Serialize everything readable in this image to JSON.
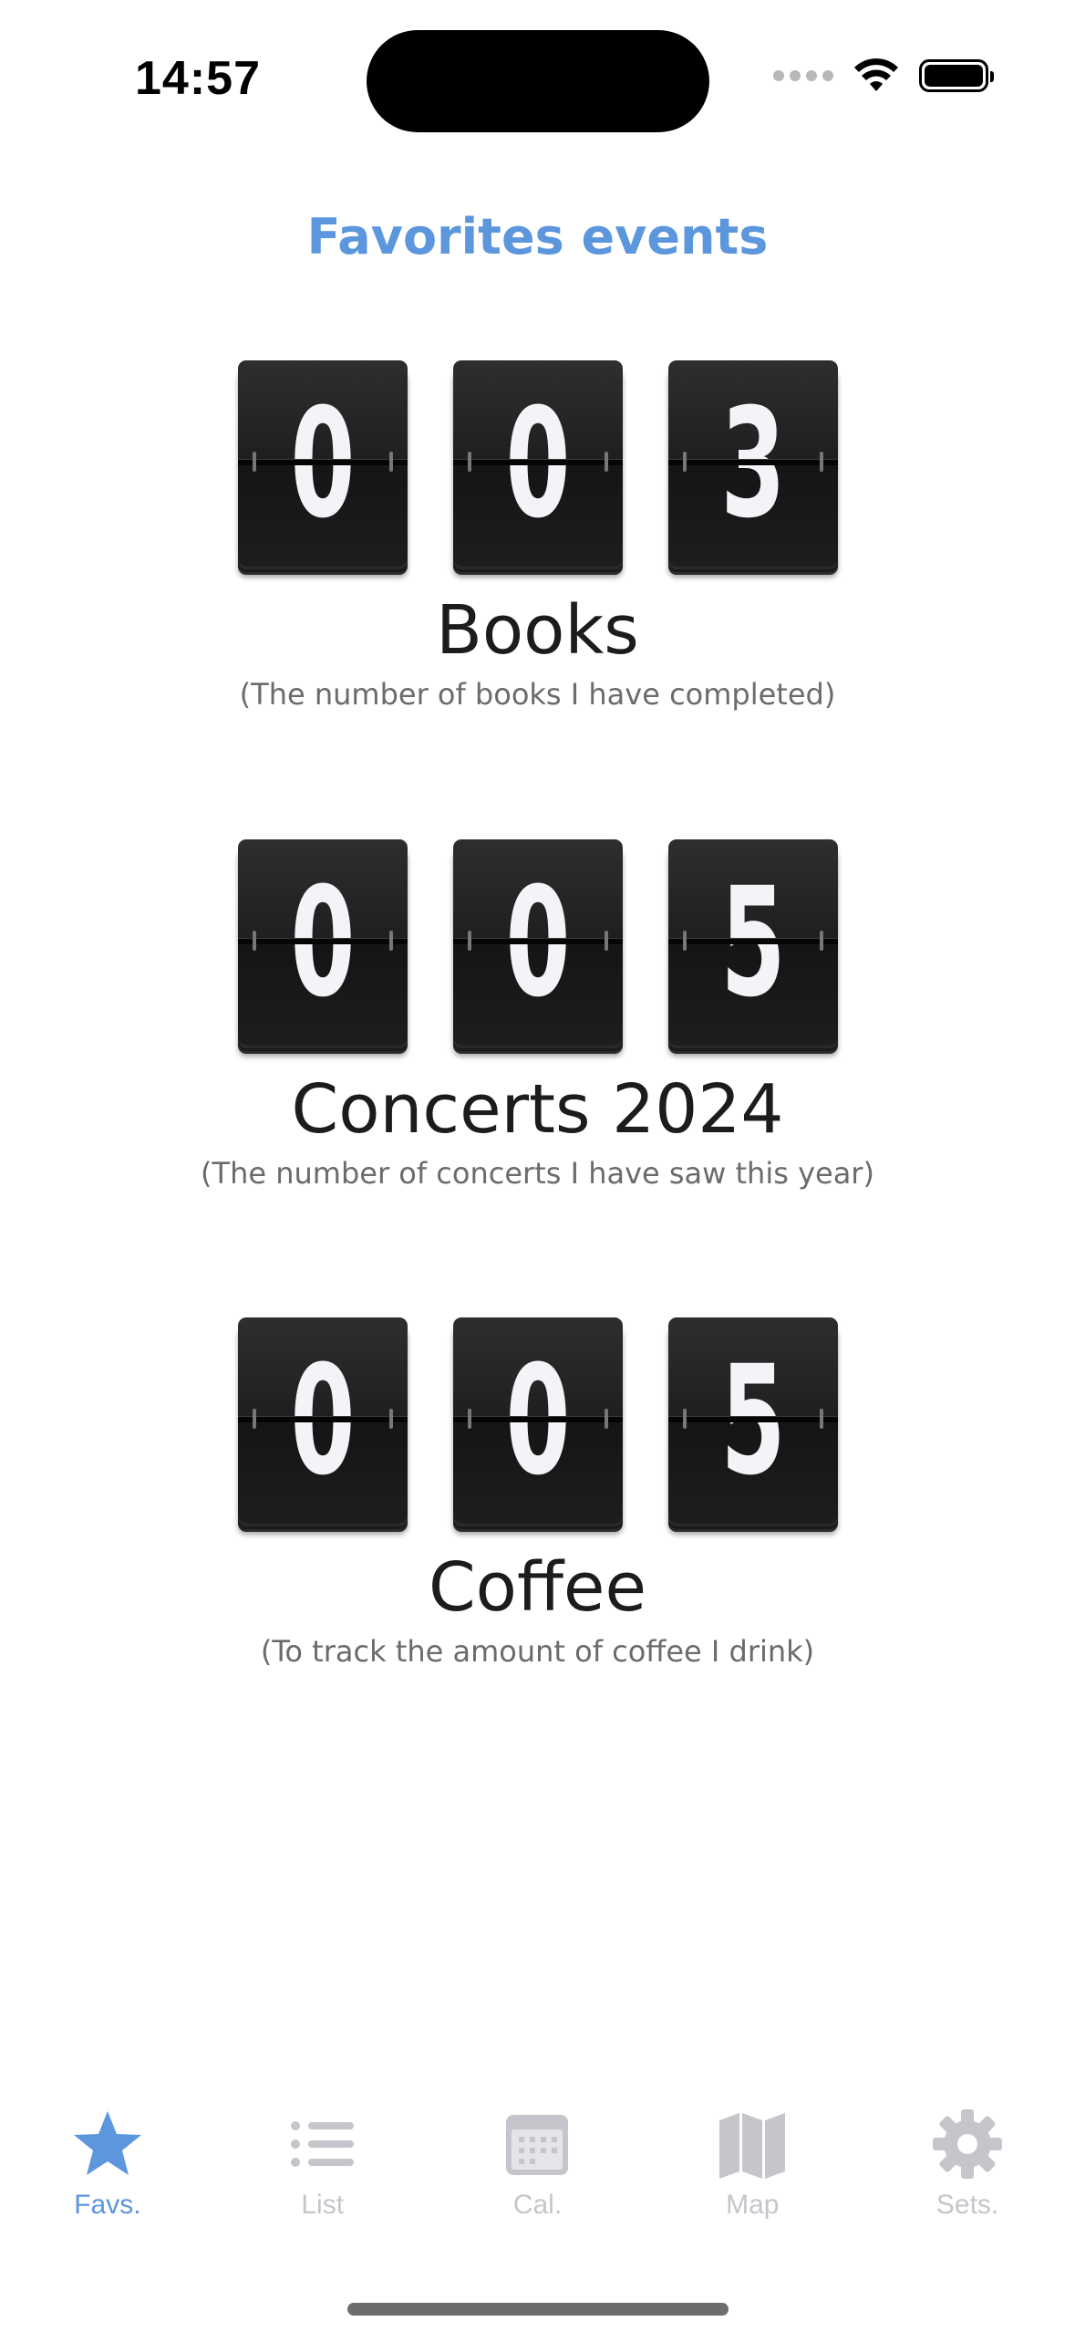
{
  "status_bar": {
    "time": "14:57"
  },
  "header": {
    "title": "Favorites events"
  },
  "counters": [
    {
      "digits": [
        "0",
        "0",
        "3"
      ],
      "title": "Books",
      "subtitle": "(The number of books I have completed)"
    },
    {
      "digits": [
        "0",
        "0",
        "5"
      ],
      "title": "Concerts 2024",
      "subtitle": "(The number of concerts I have saw this year)"
    },
    {
      "digits": [
        "0",
        "0",
        "5"
      ],
      "title": "Coffee",
      "subtitle": "(To track the amount of coffee I drink)"
    }
  ],
  "tab_bar": {
    "tabs": [
      {
        "label": "Favs.",
        "icon": "star-icon",
        "active": true
      },
      {
        "label": "List",
        "icon": "list-icon",
        "active": false
      },
      {
        "label": "Cal.",
        "icon": "calendar-icon",
        "active": false
      },
      {
        "label": "Map",
        "icon": "map-icon",
        "active": false
      },
      {
        "label": "Sets.",
        "icon": "gear-icon",
        "active": false
      }
    ]
  },
  "colors": {
    "accent": "#5c96dc",
    "inactive": "#c4c6cb",
    "flip_card": "#1f1f1f"
  }
}
